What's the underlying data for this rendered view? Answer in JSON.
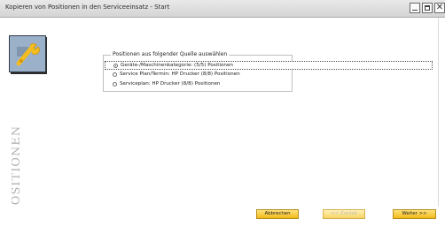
{
  "window": {
    "title": "Kopieren von Positionen in den Serviceeinsatz - Start",
    "close_glyph": "✕"
  },
  "sidebar": {
    "label": "POSITIONEN",
    "logo_icon": "wrench-icon"
  },
  "group": {
    "title": "Positionen aus folgender Quelle auswählen",
    "options": [
      {
        "label": "Geräte-/Maschinenkategorie: (5/5) Positionen",
        "selected": true
      },
      {
        "label": "Service Plan/Termin: HP Drucker (8/8) Positionen",
        "selected": false
      },
      {
        "label": "Serviceplan: HP Drucker (8/8) Positionen",
        "selected": false
      }
    ]
  },
  "buttons": {
    "cancel": "Abbrechen",
    "back": "<< Zurück",
    "next": "Weiter >>"
  },
  "colors": {
    "button_gradient_top": "#ffe27a",
    "button_gradient_bottom": "#f2ba19",
    "logo_background": "#8ea7c2"
  }
}
